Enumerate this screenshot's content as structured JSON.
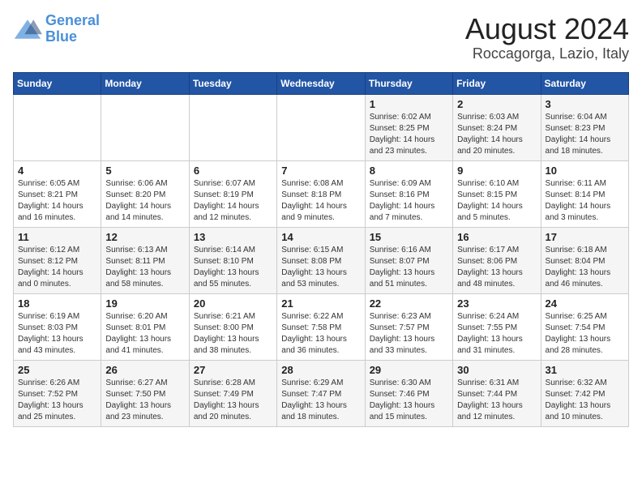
{
  "logo": {
    "line1": "General",
    "line2": "Blue"
  },
  "title": "August 2024",
  "subtitle": "Roccagorga, Lazio, Italy",
  "weekdays": [
    "Sunday",
    "Monday",
    "Tuesday",
    "Wednesday",
    "Thursday",
    "Friday",
    "Saturday"
  ],
  "weeks": [
    [
      {
        "day": "",
        "detail": ""
      },
      {
        "day": "",
        "detail": ""
      },
      {
        "day": "",
        "detail": ""
      },
      {
        "day": "",
        "detail": ""
      },
      {
        "day": "1",
        "detail": "Sunrise: 6:02 AM\nSunset: 8:25 PM\nDaylight: 14 hours\nand 23 minutes."
      },
      {
        "day": "2",
        "detail": "Sunrise: 6:03 AM\nSunset: 8:24 PM\nDaylight: 14 hours\nand 20 minutes."
      },
      {
        "day": "3",
        "detail": "Sunrise: 6:04 AM\nSunset: 8:23 PM\nDaylight: 14 hours\nand 18 minutes."
      }
    ],
    [
      {
        "day": "4",
        "detail": "Sunrise: 6:05 AM\nSunset: 8:21 PM\nDaylight: 14 hours\nand 16 minutes."
      },
      {
        "day": "5",
        "detail": "Sunrise: 6:06 AM\nSunset: 8:20 PM\nDaylight: 14 hours\nand 14 minutes."
      },
      {
        "day": "6",
        "detail": "Sunrise: 6:07 AM\nSunset: 8:19 PM\nDaylight: 14 hours\nand 12 minutes."
      },
      {
        "day": "7",
        "detail": "Sunrise: 6:08 AM\nSunset: 8:18 PM\nDaylight: 14 hours\nand 9 minutes."
      },
      {
        "day": "8",
        "detail": "Sunrise: 6:09 AM\nSunset: 8:16 PM\nDaylight: 14 hours\nand 7 minutes."
      },
      {
        "day": "9",
        "detail": "Sunrise: 6:10 AM\nSunset: 8:15 PM\nDaylight: 14 hours\nand 5 minutes."
      },
      {
        "day": "10",
        "detail": "Sunrise: 6:11 AM\nSunset: 8:14 PM\nDaylight: 14 hours\nand 3 minutes."
      }
    ],
    [
      {
        "day": "11",
        "detail": "Sunrise: 6:12 AM\nSunset: 8:12 PM\nDaylight: 14 hours\nand 0 minutes."
      },
      {
        "day": "12",
        "detail": "Sunrise: 6:13 AM\nSunset: 8:11 PM\nDaylight: 13 hours\nand 58 minutes."
      },
      {
        "day": "13",
        "detail": "Sunrise: 6:14 AM\nSunset: 8:10 PM\nDaylight: 13 hours\nand 55 minutes."
      },
      {
        "day": "14",
        "detail": "Sunrise: 6:15 AM\nSunset: 8:08 PM\nDaylight: 13 hours\nand 53 minutes."
      },
      {
        "day": "15",
        "detail": "Sunrise: 6:16 AM\nSunset: 8:07 PM\nDaylight: 13 hours\nand 51 minutes."
      },
      {
        "day": "16",
        "detail": "Sunrise: 6:17 AM\nSunset: 8:06 PM\nDaylight: 13 hours\nand 48 minutes."
      },
      {
        "day": "17",
        "detail": "Sunrise: 6:18 AM\nSunset: 8:04 PM\nDaylight: 13 hours\nand 46 minutes."
      }
    ],
    [
      {
        "day": "18",
        "detail": "Sunrise: 6:19 AM\nSunset: 8:03 PM\nDaylight: 13 hours\nand 43 minutes."
      },
      {
        "day": "19",
        "detail": "Sunrise: 6:20 AM\nSunset: 8:01 PM\nDaylight: 13 hours\nand 41 minutes."
      },
      {
        "day": "20",
        "detail": "Sunrise: 6:21 AM\nSunset: 8:00 PM\nDaylight: 13 hours\nand 38 minutes."
      },
      {
        "day": "21",
        "detail": "Sunrise: 6:22 AM\nSunset: 7:58 PM\nDaylight: 13 hours\nand 36 minutes."
      },
      {
        "day": "22",
        "detail": "Sunrise: 6:23 AM\nSunset: 7:57 PM\nDaylight: 13 hours\nand 33 minutes."
      },
      {
        "day": "23",
        "detail": "Sunrise: 6:24 AM\nSunset: 7:55 PM\nDaylight: 13 hours\nand 31 minutes."
      },
      {
        "day": "24",
        "detail": "Sunrise: 6:25 AM\nSunset: 7:54 PM\nDaylight: 13 hours\nand 28 minutes."
      }
    ],
    [
      {
        "day": "25",
        "detail": "Sunrise: 6:26 AM\nSunset: 7:52 PM\nDaylight: 13 hours\nand 25 minutes."
      },
      {
        "day": "26",
        "detail": "Sunrise: 6:27 AM\nSunset: 7:50 PM\nDaylight: 13 hours\nand 23 minutes."
      },
      {
        "day": "27",
        "detail": "Sunrise: 6:28 AM\nSunset: 7:49 PM\nDaylight: 13 hours\nand 20 minutes."
      },
      {
        "day": "28",
        "detail": "Sunrise: 6:29 AM\nSunset: 7:47 PM\nDaylight: 13 hours\nand 18 minutes."
      },
      {
        "day": "29",
        "detail": "Sunrise: 6:30 AM\nSunset: 7:46 PM\nDaylight: 13 hours\nand 15 minutes."
      },
      {
        "day": "30",
        "detail": "Sunrise: 6:31 AM\nSunset: 7:44 PM\nDaylight: 13 hours\nand 12 minutes."
      },
      {
        "day": "31",
        "detail": "Sunrise: 6:32 AM\nSunset: 7:42 PM\nDaylight: 13 hours\nand 10 minutes."
      }
    ]
  ]
}
